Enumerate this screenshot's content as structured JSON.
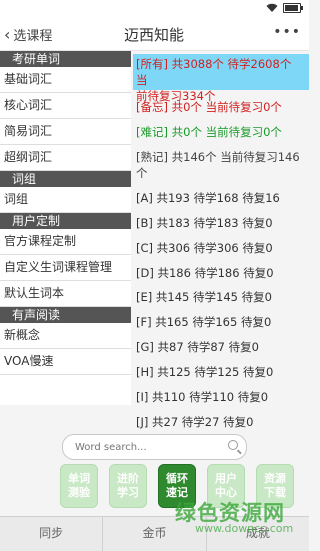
{
  "status": {
    "signal": "wifi-icon"
  },
  "header": {
    "back_label": "选课程",
    "title": "迈西知能",
    "more": "•••"
  },
  "sidebar": {
    "sections": [
      {
        "title": "考研单词",
        "items": [
          "基础词汇",
          "核心词汇",
          "简易词汇",
          "超纲词汇"
        ]
      },
      {
        "title": "词组",
        "items": [
          "词组"
        ]
      },
      {
        "title": "用户定制",
        "items": [
          "官方课程定制",
          "自定义生词课程管理",
          "默认生词本"
        ]
      },
      {
        "title": "有声阅读",
        "items": [
          "新概念",
          "VOA慢速"
        ]
      }
    ]
  },
  "stats": {
    "all_line1": "[所有] 共3088个 待学2608个 当",
    "all_line2": "前待复习334个",
    "red": "[备忘] 共0个 当前待复习0个",
    "green": "[难记] 共0个 当前待复习0个",
    "gray_line1": "[熟记] 共146个 当前待复习146",
    "gray_line2": "个",
    "letters": [
      "[A] 共193 待学168 待复16",
      "[B] 共183 待学183 待复0",
      "[C] 共306 待学306 待复0",
      "[D] 共186 待学186 待复0",
      "[E] 共145 待学145 待复0",
      "[F] 共165 待学165 待复0",
      "[G] 共87 待学87 待复0",
      "[H] 共125 待学125 待复0",
      "[I] 共110 待学110 待复0",
      "[J] 共27 待学27 待复0"
    ]
  },
  "search": {
    "placeholder": "Word search..."
  },
  "buttons": [
    {
      "line1": "单词",
      "line2": "测验"
    },
    {
      "line1": "进阶",
      "line2": "学习"
    },
    {
      "line1": "循环",
      "line2": "速记"
    },
    {
      "line1": "用户",
      "line2": "中心"
    },
    {
      "line1": "资源",
      "line2": "下载"
    }
  ],
  "bottom_tabs": [
    "同步",
    "金币",
    "成就"
  ],
  "watermark": {
    "text": "绿色资源网",
    "url": "www.downcc.com"
  }
}
